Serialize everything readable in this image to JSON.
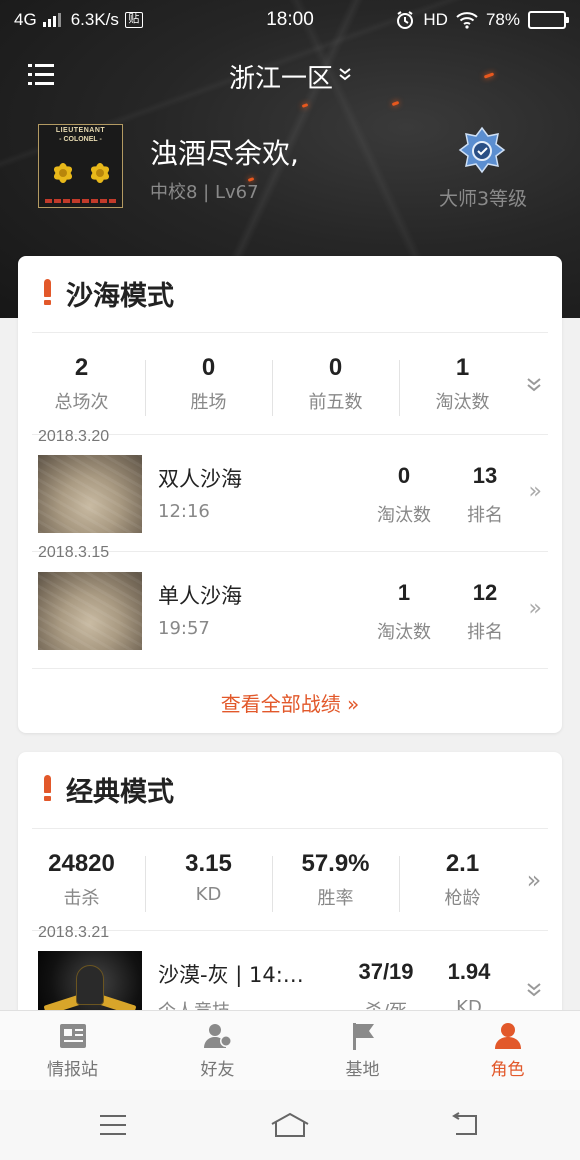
{
  "status_bar": {
    "network": "4G",
    "speed": "6.3K/s",
    "notify_glyph": "贴",
    "time": "18:00",
    "hd": "HD",
    "battery": "78%",
    "battery_level": 0.78
  },
  "header": {
    "server": "浙江一区",
    "server_chevron": "›"
  },
  "profile": {
    "rank_badge_line1": "LIEUTENANT",
    "rank_badge_line2": "- COLONEL -",
    "name": "浊酒尽余欢,",
    "level": "中校8 | Lv67",
    "tier": "大师3等级"
  },
  "desert_mode": {
    "title": "沙海模式",
    "stats": [
      {
        "value": "2",
        "label": "总场次"
      },
      {
        "value": "0",
        "label": "胜场"
      },
      {
        "value": "0",
        "label": "前五数"
      },
      {
        "value": "1",
        "label": "淘汰数"
      }
    ],
    "matches": [
      {
        "date": "2018.3.20",
        "name": "双人沙海",
        "time": "12:16",
        "elims": "0",
        "elims_label": "淘汰数",
        "rank": "13",
        "rank_label": "排名"
      },
      {
        "date": "2018.3.15",
        "name": "单人沙海",
        "time": "19:57",
        "elims": "1",
        "elims_label": "淘汰数",
        "rank": "12",
        "rank_label": "排名"
      }
    ],
    "view_all": "查看全部战绩 »"
  },
  "classic_mode": {
    "title": "经典模式",
    "stats": [
      {
        "value": "24820",
        "label": "击杀"
      },
      {
        "value": "3.15",
        "label": "KD"
      },
      {
        "value": "57.9%",
        "label": "胜率"
      },
      {
        "value": "2.1",
        "label": "枪龄"
      }
    ],
    "matches": [
      {
        "date": "2018.3.21",
        "name": "沙漠-灰 | 14:…",
        "sub": "个人竞技",
        "kills": "37/19",
        "kills_label": "杀/死",
        "kd": "1.94",
        "kd_label": "KD"
      }
    ]
  },
  "tabbar": {
    "tabs": [
      {
        "label": "情报站",
        "icon": "news-icon"
      },
      {
        "label": "好友",
        "icon": "friends-icon"
      },
      {
        "label": "基地",
        "icon": "flag-icon"
      },
      {
        "label": "角色",
        "icon": "profile-icon"
      }
    ],
    "active_index": 3
  },
  "colors": {
    "accent": "#e2582a",
    "hero_bg": "#262626",
    "battery": "#f6c21a"
  }
}
